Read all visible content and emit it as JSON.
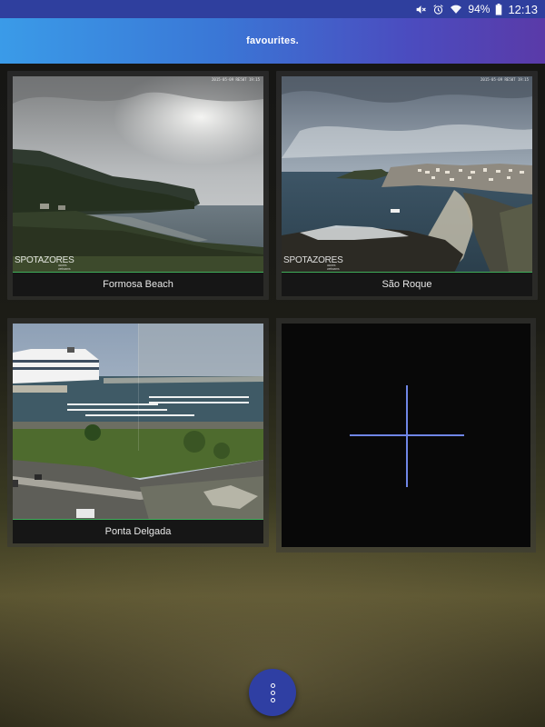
{
  "status_bar": {
    "battery": "94%",
    "time": "12:13",
    "icons": [
      "mute-icon",
      "alarm-icon",
      "wifi-icon",
      "battery-icon"
    ],
    "color": "#2f3f9e"
  },
  "app_bar": {
    "title": "favourites."
  },
  "favourites": [
    {
      "name": "Formosa Beach",
      "stamp": "2015-05-09 RE50T 19:15",
      "brand": "SPOTAZORES",
      "brand_sub": "azores webcams"
    },
    {
      "name": "São Roque",
      "stamp": "2015-05-09 RE50T 19:15",
      "brand": "SPOTAZORES",
      "brand_sub": "azores webcams"
    },
    {
      "name": "Ponta Delgada"
    }
  ],
  "add_tile": {
    "icon": "plus-icon",
    "accent": "#6f86e6"
  },
  "fab": {
    "icon": "more-vertical-icon",
    "color": "#2f3fa3"
  }
}
